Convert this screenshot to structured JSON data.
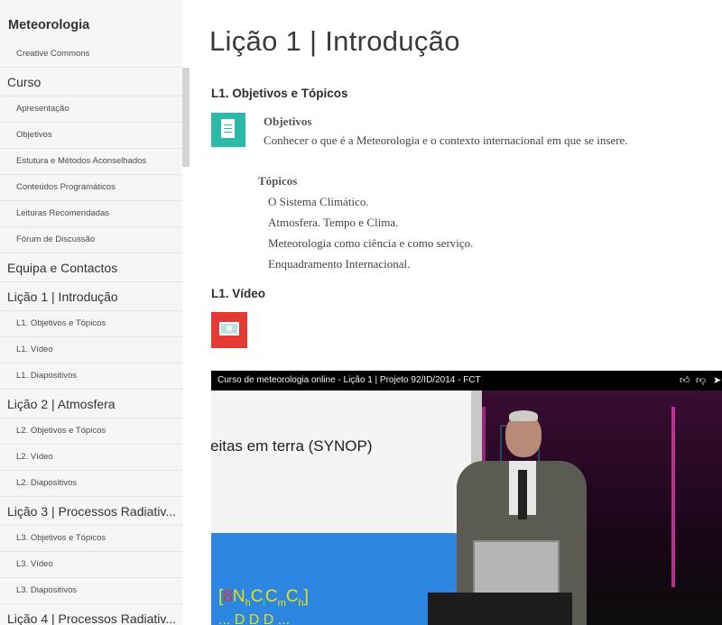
{
  "sidebar": {
    "brand": "Meteorologia",
    "items": [
      {
        "type": "sub",
        "label": "Creative Commons"
      },
      {
        "type": "section",
        "label": "Curso"
      },
      {
        "type": "sub",
        "label": "Apresentação"
      },
      {
        "type": "sub",
        "label": "Objetivos"
      },
      {
        "type": "sub",
        "label": "Estutura e Métodos Aconselhados"
      },
      {
        "type": "sub",
        "label": "Conteúdos Programáticos"
      },
      {
        "type": "sub",
        "label": "Leituras Recomendadas"
      },
      {
        "type": "sub",
        "label": "Fórum de Discussão"
      },
      {
        "type": "section",
        "label": "Equipa e Contactos"
      },
      {
        "type": "section",
        "label": "Lição 1 | Introdução"
      },
      {
        "type": "sub",
        "label": "L1. Objetivos e Tópicos"
      },
      {
        "type": "sub",
        "label": "L1. Vídeo"
      },
      {
        "type": "sub",
        "label": "L1. Diapositivos"
      },
      {
        "type": "section",
        "label": "Lição 2 | Atmosfera"
      },
      {
        "type": "sub",
        "label": "L2. Objetivos e Tópicos"
      },
      {
        "type": "sub",
        "label": "L2. Vídeo"
      },
      {
        "type": "sub",
        "label": "L2. Diapositivos"
      },
      {
        "type": "section",
        "label": "Lição 3 | Processos Radiativ..."
      },
      {
        "type": "sub",
        "label": "L3. Objetivos e Tópicos"
      },
      {
        "type": "sub",
        "label": "L3. Vídeo"
      },
      {
        "type": "sub",
        "label": "L3. Diapositivos"
      },
      {
        "type": "section",
        "label": "Lição 4 | Processos Radiativ..."
      }
    ]
  },
  "main": {
    "title": "Lição 1 | Introdução",
    "section1": {
      "heading": "L1. Objetivos e Tópicos",
      "objetivos_heading": "Objetivos",
      "objetivos_text": "Conhecer o que é a Meteorologia e o contexto internacional em que se insere.",
      "topicos_heading": "Tópicos",
      "topicos": [
        "O Sistema Climático.",
        "Atmosfera. Tempo e Clima.",
        "Meteorologia como ciência e como serviço.",
        "Enquadramento Internacional."
      ]
    },
    "section2": {
      "heading": "L1. Vídeo"
    },
    "video": {
      "title": "Curso de meteorologia online - Lição 1 | Projeto 92/ID/2014 - FCT",
      "slide_text": "eitas em terra (SYNOP)",
      "formula_open": "[",
      "formula_8": "8",
      "formula_N": "N",
      "formula_h": "h",
      "formula_C1": "C",
      "formula_l": "l",
      "formula_C2": "C",
      "formula_m": "m",
      "formula_C3": "C",
      "formula_h2": "h",
      "formula_close": "]",
      "formula2": "... D D D ..."
    }
  },
  "colors": {
    "sidebar_bg": "#f7f6f5",
    "doc_icon": "#2bb9a8",
    "video_icon": "#e43a34",
    "slide_blue": "#2d86e2"
  }
}
